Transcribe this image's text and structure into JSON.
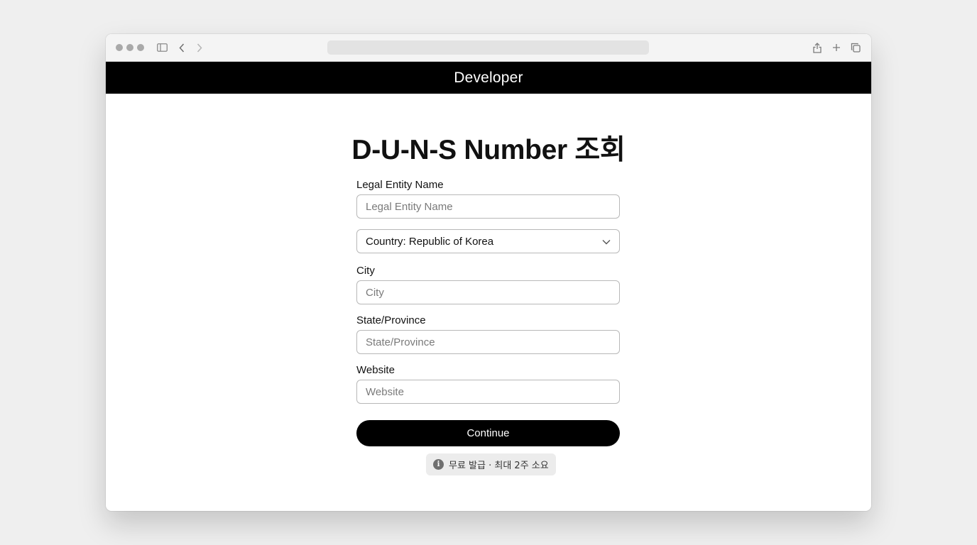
{
  "browser": {
    "icons": [
      "window-dots",
      "sidebar-icon",
      "back-icon",
      "forward-icon",
      "share-icon",
      "new-tab-icon",
      "tabs-overview-icon"
    ]
  },
  "header": {
    "title": "Developer"
  },
  "page": {
    "title": "D-U-N-S Number 조회"
  },
  "form": {
    "legal_name_label": "Legal Entity Name",
    "legal_name_placeholder": "Legal Entity Name",
    "country_value": "Country: Republic of Korea",
    "city_label": "City",
    "city_placeholder": "City",
    "state_label": "State/Province",
    "state_placeholder": "State/Province",
    "website_label": "Website",
    "website_placeholder": "Website",
    "continue_label": "Continue"
  },
  "notice": {
    "icon_glyph": "i",
    "text": "무료 발급 · 최대 2주 소요"
  },
  "colors": {
    "header_bg": "#000000",
    "button_bg": "#000000",
    "background": "#efefef"
  }
}
